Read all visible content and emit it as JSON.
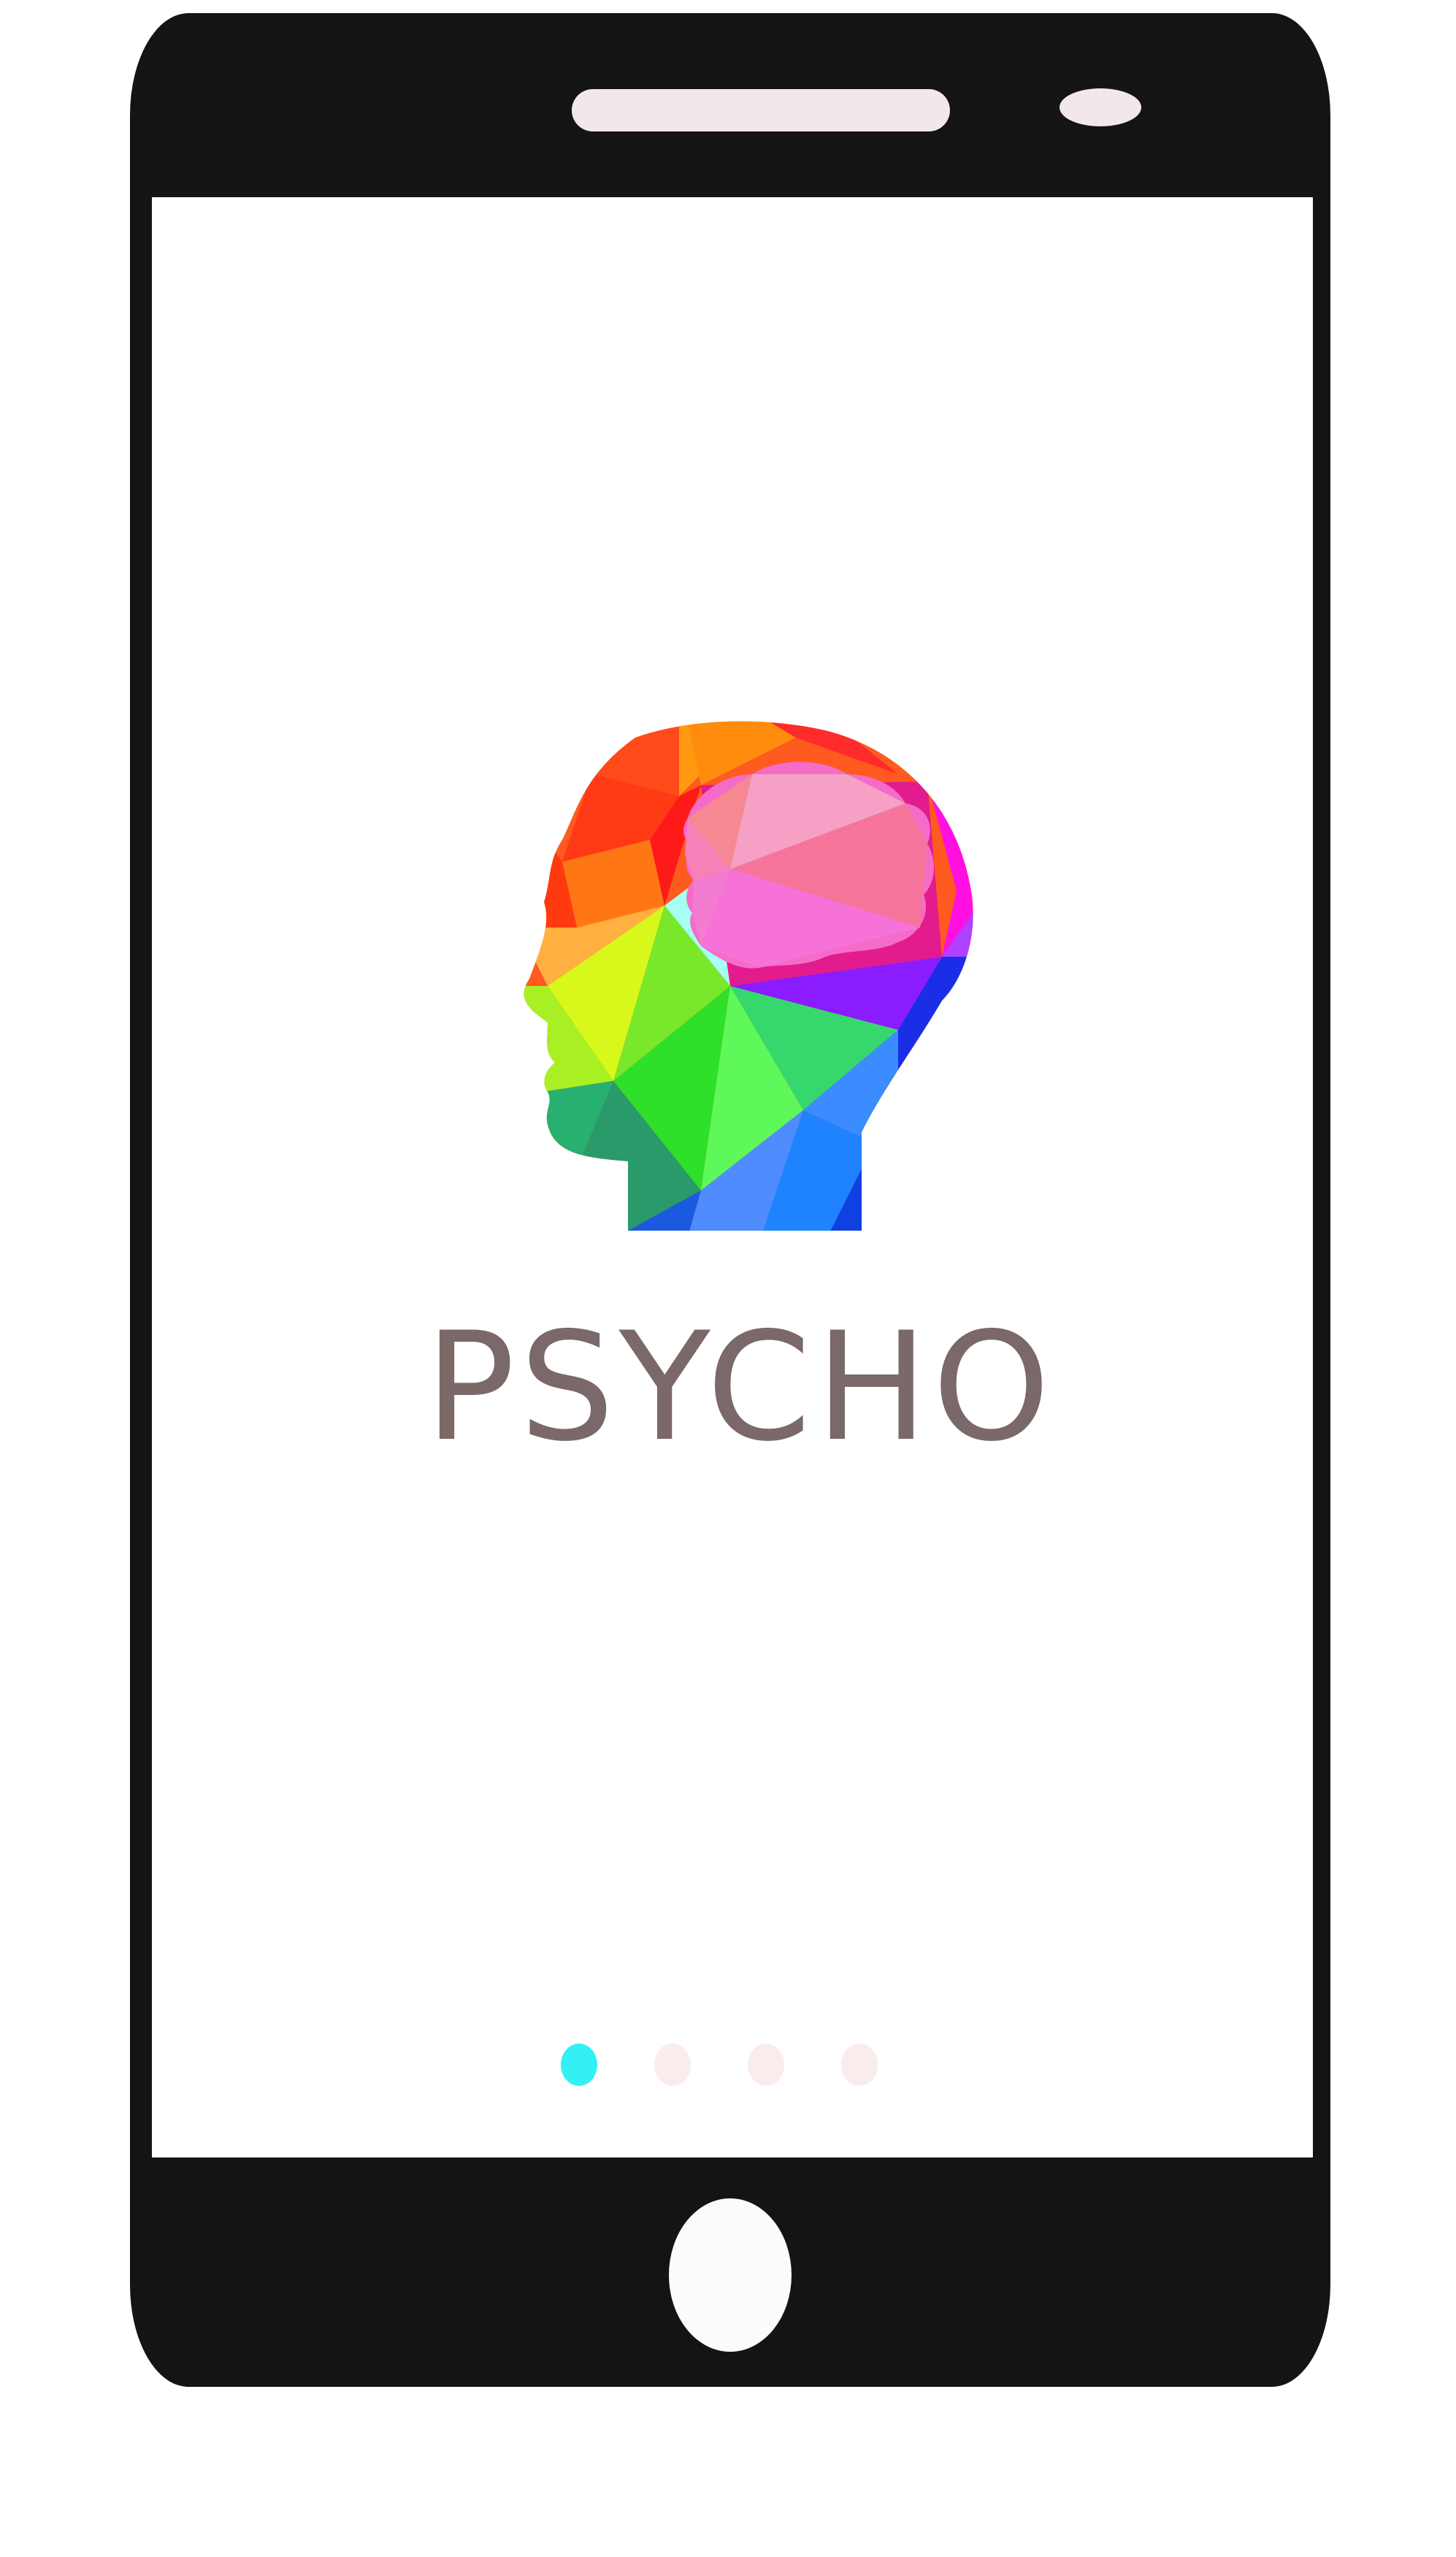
{
  "app": {
    "title": "PSYCHO"
  },
  "pager": {
    "total_pages": 4,
    "active_page": 1
  },
  "colors": {
    "device_body": "#141414",
    "screen": "#ffffff",
    "title_text": "#7b6868",
    "dot_active": "#33f0f5",
    "dot_inactive": "#fbecec",
    "speaker": "#f2e8ea"
  },
  "icons": {
    "logo": "polygonal-head-brain-icon"
  }
}
